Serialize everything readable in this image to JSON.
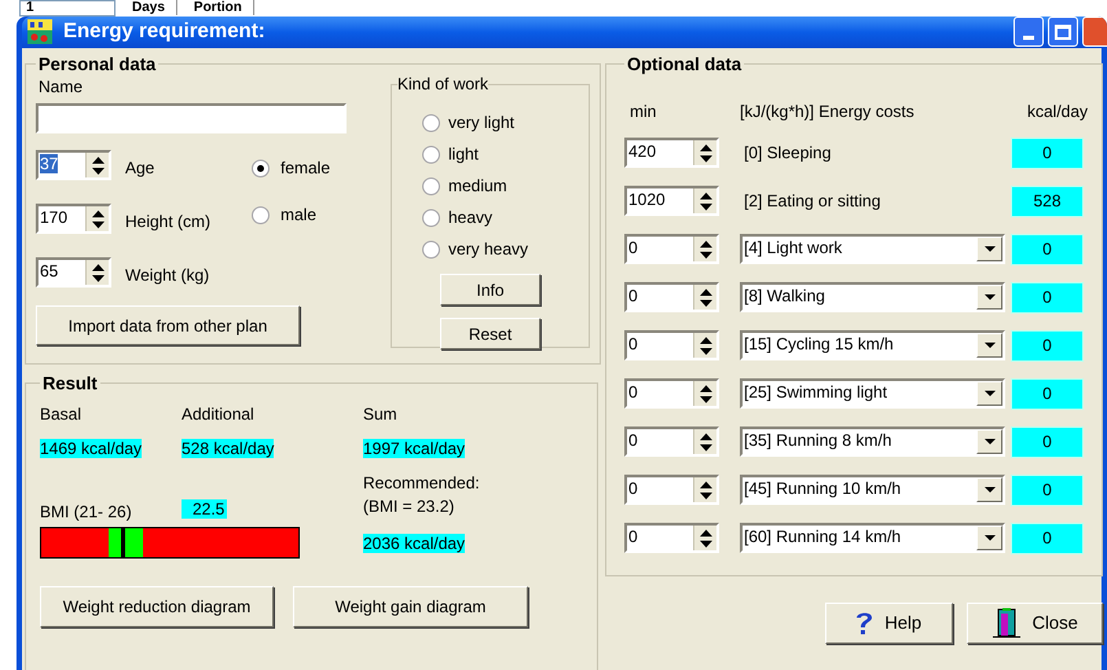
{
  "background_window": {
    "spinner_value": "1",
    "labels": [
      "Days",
      "Portion"
    ]
  },
  "window": {
    "title": "Energy requirement:"
  },
  "personal_data": {
    "title": "Personal data",
    "name_label": "Name",
    "fields": [
      {
        "label": "Age",
        "value": "37",
        "text_selected": true
      },
      {
        "label": "Height (cm)",
        "value": "170",
        "text_selected": false
      },
      {
        "label": "Weight (kg)",
        "value": "65",
        "text_selected": false
      }
    ],
    "gender": [
      {
        "label": "female",
        "selected": true
      },
      {
        "label": "male",
        "selected": false
      }
    ],
    "import_button": "Import data from other plan"
  },
  "kind_of_work": {
    "title": "Kind of work",
    "options": [
      {
        "label": "very light",
        "selected": false
      },
      {
        "label": "light",
        "selected": false
      },
      {
        "label": "medium",
        "selected": false
      },
      {
        "label": "heavy",
        "selected": false
      },
      {
        "label": "very heavy",
        "selected": false
      }
    ],
    "buttons": [
      "Info",
      "Reset"
    ]
  },
  "result": {
    "title": "Result",
    "basal_label": "Basal",
    "basal_value": "1469 kcal/day",
    "additional_label": "Additional",
    "additional_value": "528 kcal/day",
    "sum_label": "Sum",
    "sum_value": "1997 kcal/day",
    "recommended_label": "Recommended:",
    "recommended_bmi": "(BMI = 23.2)",
    "recommended_value": "2036 kcal/day",
    "bmi_label": "BMI (21- 26)",
    "bmi_value": "22.5",
    "bmi_gauge": {
      "level": 0.31
    },
    "buttons": [
      "Weight reduction diagram",
      "Weight gain diagram"
    ]
  },
  "optional_data": {
    "title": "Optional data",
    "columns": [
      "min",
      "[kJ/(kg*h)] Energy costs",
      "kcal/day"
    ],
    "rows": [
      {
        "minutes": "420",
        "kind": "label",
        "activity": "[0] Sleeping",
        "kcal": "0"
      },
      {
        "minutes": "1020",
        "kind": "label",
        "activity": "[2] Eating or sitting",
        "kcal": "528"
      },
      {
        "minutes": "0",
        "kind": "dropdown",
        "activity": "[4] Light work",
        "kcal": "0"
      },
      {
        "minutes": "0",
        "kind": "dropdown",
        "activity": "[8] Walking",
        "kcal": "0"
      },
      {
        "minutes": "0",
        "kind": "dropdown",
        "activity": "[15] Cycling 15 km/h",
        "kcal": "0"
      },
      {
        "minutes": "0",
        "kind": "dropdown",
        "activity": "[25] Swimming light",
        "kcal": "0"
      },
      {
        "minutes": "0",
        "kind": "dropdown",
        "activity": "[35] Running 8 km/h",
        "kcal": "0"
      },
      {
        "minutes": "0",
        "kind": "dropdown",
        "activity": "[45] Running 10 km/h",
        "kcal": "0"
      },
      {
        "minutes": "0",
        "kind": "dropdown",
        "activity": "[60] Running 14 km/h",
        "kcal": "0"
      }
    ]
  },
  "footer_buttons": [
    {
      "label": "Help",
      "kind": "help"
    },
    {
      "label": "Close",
      "kind": "close"
    }
  ]
}
